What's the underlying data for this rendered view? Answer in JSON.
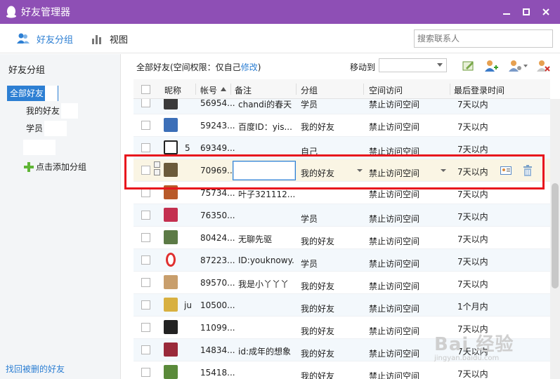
{
  "window": {
    "title": "好友管理器"
  },
  "toolbar": {
    "friend_group_label": "好友分组",
    "view_label": "视图",
    "search_placeholder": "搜索联系人"
  },
  "sidebar": {
    "heading": "好友分组",
    "groups": [
      {
        "label": "全部好友"
      },
      {
        "label": "我的好友"
      },
      {
        "label": "学员"
      },
      {
        "label": ""
      }
    ],
    "add_group_label": "点击添加分组",
    "restore_link": "找回被删的好友"
  },
  "main": {
    "scope_text": "全部好友(空间权限：仅自己",
    "scope_link": "修改",
    "scope_close": ")",
    "moveto_label": "移动到",
    "moveto_value": ""
  },
  "table": {
    "columns": [
      "昵称",
      "帐号",
      "备注",
      "分组",
      "空间访问",
      "最后登录时间"
    ],
    "rows": [
      {
        "nick": "",
        "account": "56954...",
        "note": "chandi的春天",
        "group": "学员",
        "access": "禁止访问空间",
        "last_login": "7天以内",
        "avatar_color": "#3a3a3a"
      },
      {
        "nick": "",
        "account": "59243...",
        "note": "百度ID：yis...",
        "group": "我的好友",
        "access": "禁止访问空间",
        "last_login": "7天以内",
        "avatar_color": "#3c6fb8"
      },
      {
        "nick": "5",
        "account": "69349...",
        "note": "",
        "group": "自己",
        "access": "禁止访问空间",
        "last_login": "7天以内",
        "avatar_color": "#ffffff"
      },
      {
        "nick": "",
        "account": "70969...",
        "note": "",
        "group": "我的好友",
        "access": "禁止访问空间",
        "last_login": "7天以内",
        "avatar_color": "#6b5a3a"
      },
      {
        "nick": "",
        "account": "75734...",
        "note": "叶子321112...",
        "group": "",
        "access": "禁止访问空间",
        "last_login": "7天以内",
        "avatar_color": "#b85a2a"
      },
      {
        "nick": "",
        "account": "76350...",
        "note": "",
        "group": "学员",
        "access": "禁止访问空间",
        "last_login": "7天以内",
        "avatar_color": "#c43050"
      },
      {
        "nick": "",
        "account": "80424...",
        "note": "无聊先驱",
        "group": "我的好友",
        "access": "禁止访问空间",
        "last_login": "7天以内",
        "avatar_color": "#5c7a46"
      },
      {
        "nick": "",
        "account": "87223...",
        "note": "ID:youknowy...",
        "group": "学员",
        "access": "禁止访问空间",
        "last_login": "7天以内",
        "avatar_color": "#e03030"
      },
      {
        "nick": "",
        "account": "89570...",
        "note": "我是小丫丫丫",
        "group": "我的好友",
        "access": "禁止访问空间",
        "last_login": "7天以内",
        "avatar_color": "#c89e6c"
      },
      {
        "nick": "ju",
        "account": "10500...",
        "note": "",
        "group": "我的好友",
        "access": "禁止访问空间",
        "last_login": "1个月内",
        "avatar_color": "#d8b040"
      },
      {
        "nick": "",
        "account": "11099...",
        "note": "",
        "group": "我的好友",
        "access": "禁止访问空间",
        "last_login": "7天以内",
        "avatar_color": "#222222"
      },
      {
        "nick": "",
        "account": "14834...",
        "note": "id:成年的想象",
        "group": "我的好友",
        "access": "禁止访问空间",
        "last_login": "7天以内",
        "avatar_color": "#9a2a3a"
      },
      {
        "nick": "",
        "account": "15418...",
        "note": "",
        "group": "我的好友",
        "access": "禁止访问空间",
        "last_login": "7天以内",
        "avatar_color": "#5a8a3a"
      }
    ]
  },
  "watermark": {
    "text": "Bai 经验",
    "sub": "jingyan.baidu.com"
  },
  "colors": {
    "titlebar": "#8e4fb5",
    "accent": "#2d7fd3",
    "highlight": "#e8161d"
  }
}
